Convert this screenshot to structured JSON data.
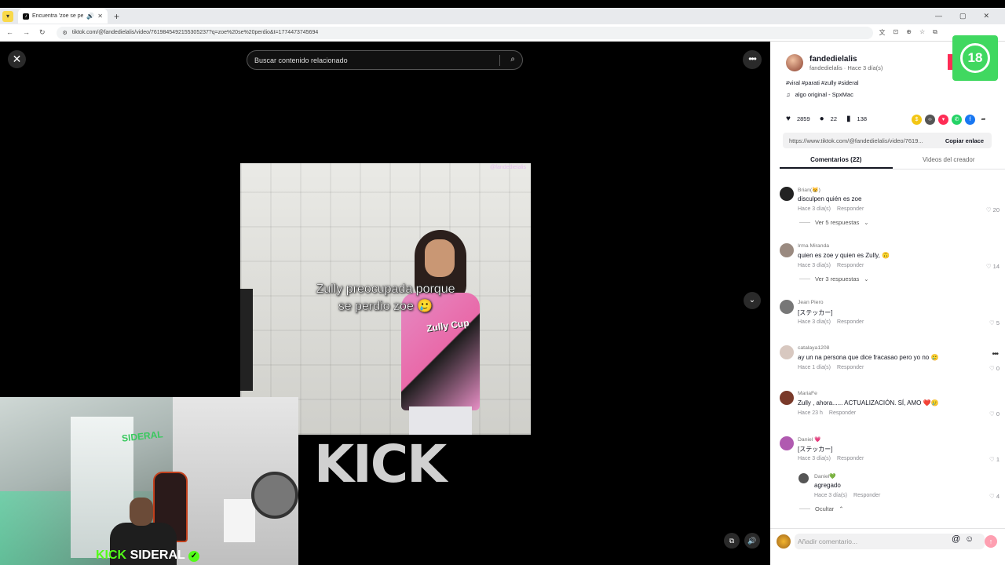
{
  "browser": {
    "tab_title": "Encuentra 'zoe se perdió' c",
    "url": "tiktok.com/@fandedielalis/video/7619845492155305237?q=zoe%20se%20perdio&t=1774473745694"
  },
  "search": {
    "placeholder": "Buscar contenido relacionado"
  },
  "video": {
    "caption_line1": "Zully preocupada porque",
    "caption_line2": "se perdio zoe 🥲",
    "watermark": "@fandedielalis",
    "shirt_text": "Zully Cup",
    "overlay_logo": "KICK"
  },
  "streamer": {
    "brand_kick": "KICK",
    "brand_name": "SIDERAL",
    "wall_sign": "SIDERAL"
  },
  "post": {
    "author": "fandedielalis",
    "author_sub": "fandedielalis · Hace 3 día(s)",
    "hashtags": "#viral #parati #zully #sideral",
    "music": "algo original - SpxMac",
    "badge": "18",
    "likes": "2859",
    "comments": "22",
    "saves": "138",
    "link": "https://www.tiktok.com/@fandedielalis/video/7619...",
    "copy_label": "Copiar enlace"
  },
  "tabs": {
    "comments": "Comentarios (22)",
    "creator_videos": "Videos del creador"
  },
  "comments": [
    {
      "user": "Brian(😸)",
      "text": "disculpen quién es zoe",
      "time": "Hace 3 día(s)",
      "reply": "Responder",
      "likes": "20",
      "more": "Ver 5 respuestas"
    },
    {
      "user": "Irma Miranda",
      "text": "quien es zoe y quien es Zully, 🙃",
      "time": "Hace 3 día(s)",
      "reply": "Responder",
      "likes": "14",
      "more": "Ver 3 respuestas"
    },
    {
      "user": "Jean Piero",
      "text": "[ステッカー]",
      "time": "Hace 3 día(s)",
      "reply": "Responder",
      "likes": "5"
    },
    {
      "user": "catalaya1208",
      "text": "ay un na persona que dice fracasao pero yo no 🥲",
      "time": "Hace 1 día(s)",
      "reply": "Responder",
      "likes": "0"
    },
    {
      "user": "MariaFe",
      "text": "Zully , ahora...... ACTUALIZACIÓN. SÍ, AMO ❤️🥲",
      "time": "Hace 23 h",
      "reply": "Responder",
      "likes": "0"
    },
    {
      "user": "Daniel 💗",
      "text": "[ステッカー]",
      "time": "Hace 3 día(s)",
      "reply": "Responder",
      "likes": "1"
    },
    {
      "user": "Daniel💚",
      "text": "agregado",
      "time": "Hace 3 día(s)",
      "reply": "Responder",
      "likes": "4",
      "more": "Ocultar"
    }
  ],
  "composer": {
    "placeholder": "Añadir comentario..."
  }
}
